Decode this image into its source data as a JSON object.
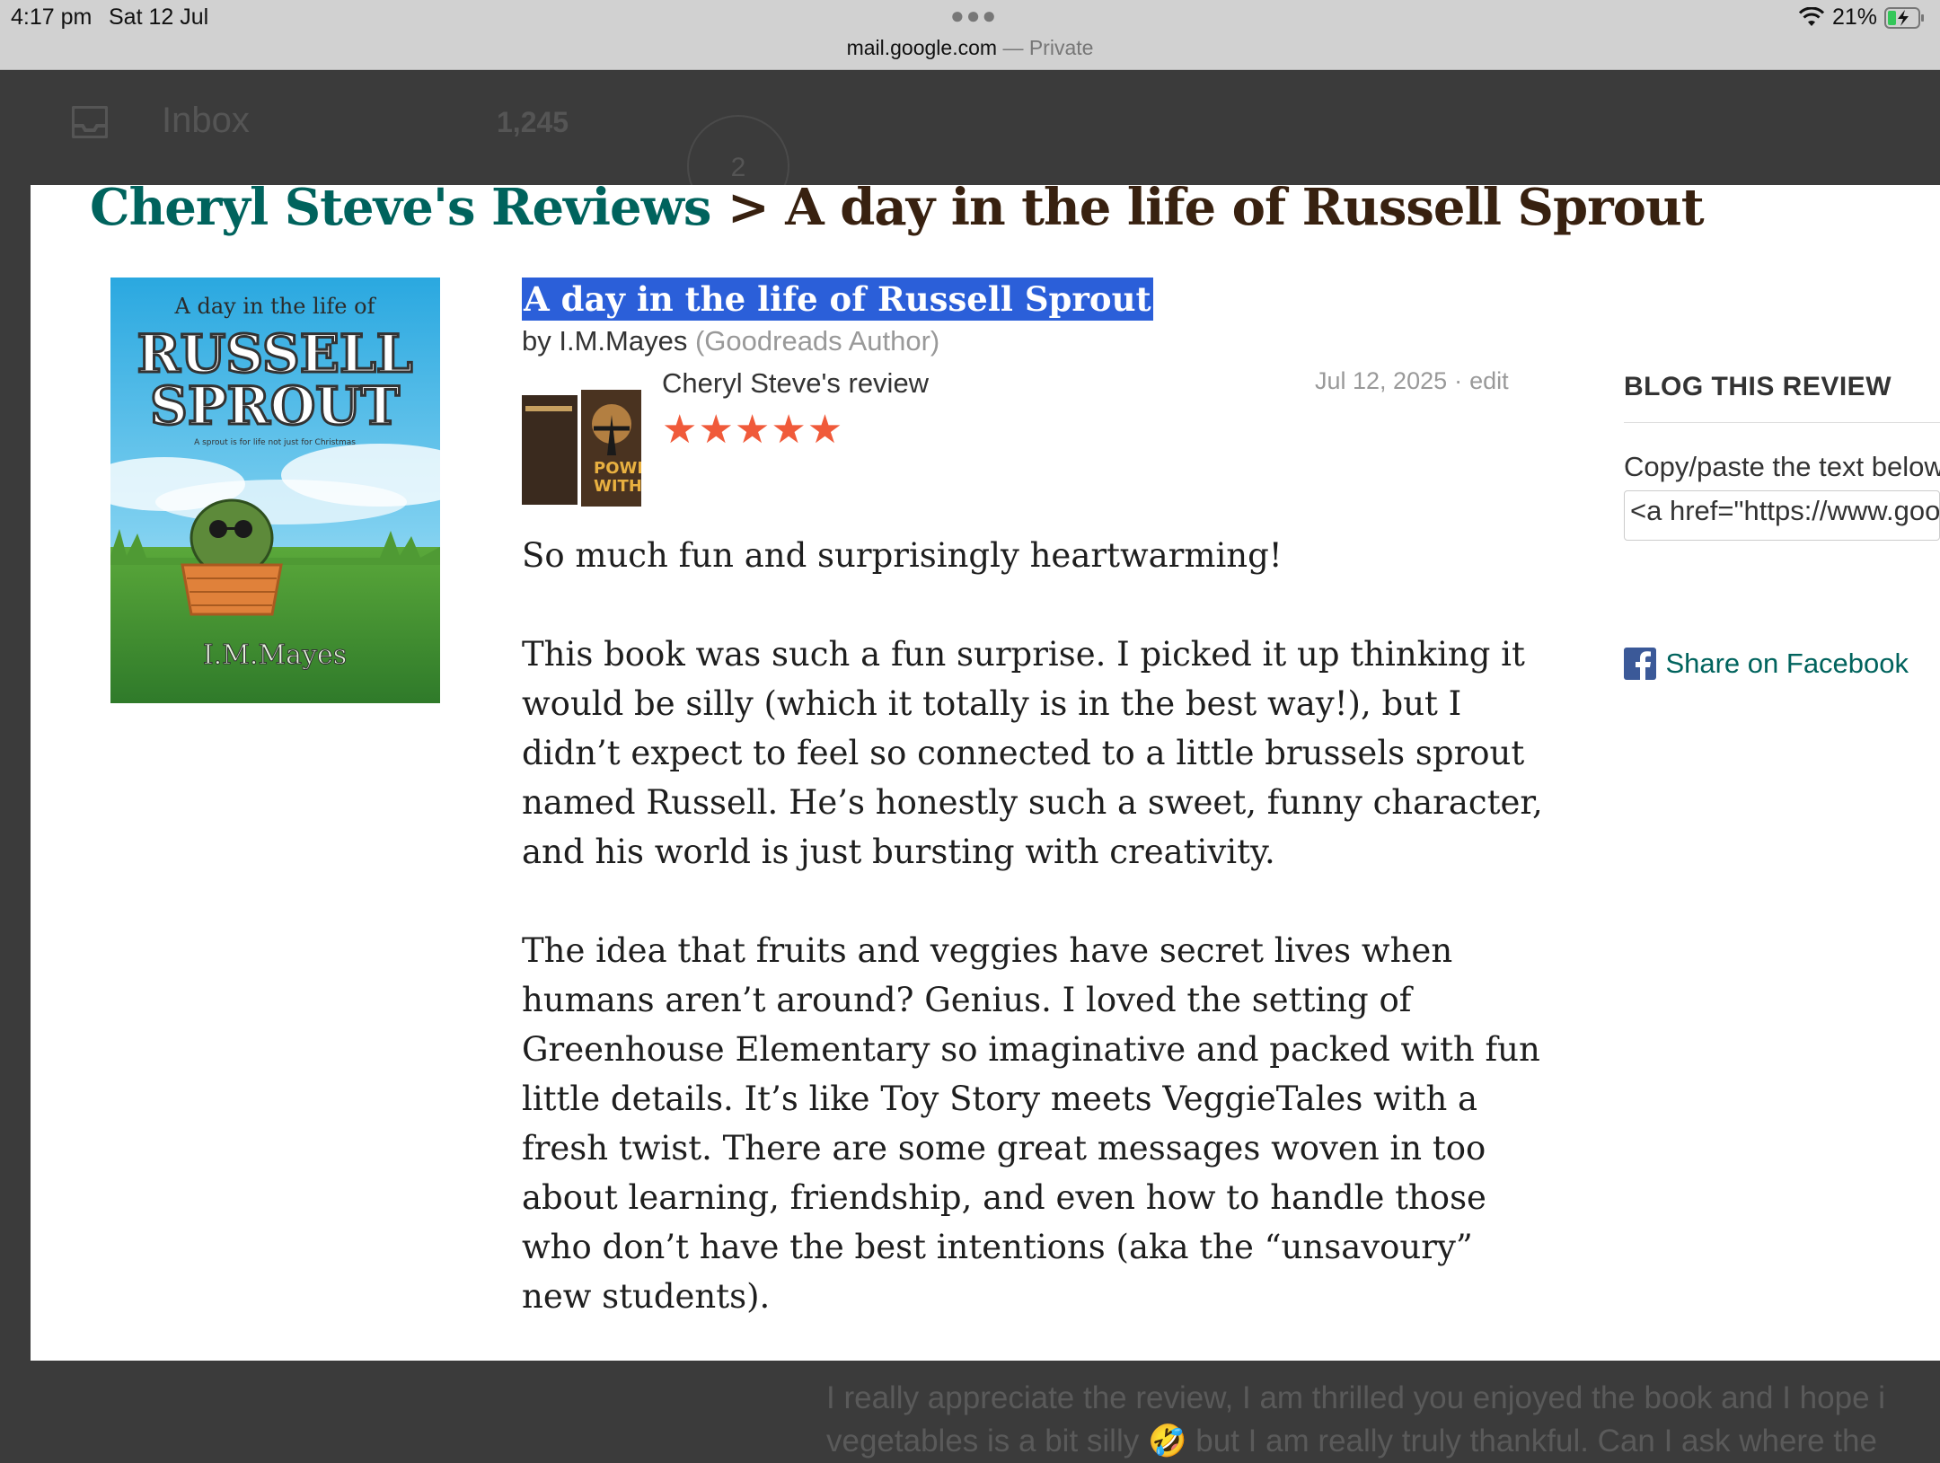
{
  "status_bar": {
    "time": "4:17 pm",
    "date": "Sat 12 Jul",
    "url": "mail.google.com",
    "private_label": "— Private",
    "battery": "21%",
    "icons": [
      "more-dots-icon",
      "wifi-icon",
      "battery-charging-icon"
    ]
  },
  "gmail_background": {
    "inbox_label": "Inbox",
    "inbox_count": "1,245",
    "badge": "2",
    "reply_lines": [
      "I really appreciate the review, I am thrilled you enjoyed the book and I hope i",
      "vegetables is a bit silly 🤣 but I am really truly thankful. Can I ask where the"
    ]
  },
  "review_page": {
    "breadcrumb_reviewer": "Cheryl Steve's Reviews",
    "breadcrumb_separator": ">",
    "breadcrumb_book": "A day in the life of Russell Sprout",
    "book_title": "A day in the life of Russell Sprout",
    "by": "by",
    "author": "I.M.Mayes",
    "author_tag": "(Goodreads Author)",
    "cover": {
      "small_title": "A day in the life of",
      "title_line1": "RUSSELL",
      "title_line2": "SPROUT",
      "tagline": "A sprout is for life not just for Christmas",
      "cover_author": "I.M.Mayes"
    },
    "avatar_text": [
      "POWE",
      "WITHI"
    ],
    "reviewer_label": "Cheryl Steve's review",
    "rating": 5,
    "stars": "★★★★★",
    "review_date": "Jul 12, 2025",
    "date_separator": "·",
    "edit_label": "edit",
    "review_paragraphs": [
      "So much fun and surprisingly heartwarming!",
      "This book was such a fun surprise. I picked it up thinking it\nwould be silly (which it totally is in the best way!), but I\ndidn’t expect to feel so connected to a little brussels sprout\nnamed Russell. He’s honestly such a sweet, funny character,\nand his world is just bursting with creativity.",
      "The idea that fruits and veggies have secret lives when\nhumans aren’t around? Genius. I loved the setting of\nGreenhouse Elementary so imaginative and packed with fun\nlittle details. It’s like Toy Story meets VeggieTales with a\nfresh twist. There are some great messages woven in too\nabout learning, friendship, and even how to handle those\nwho don’t have the best intentions (aka the “unsavoury”\nnew students)."
    ],
    "blog_heading": "BLOG THIS REVIEW",
    "blog_instructions": "Copy/paste the text below",
    "blog_code": "<a href=\"https://www.goodreads.com",
    "share_facebook": "Share on Facebook",
    "colors": {
      "goodreads_teal": "#00635d",
      "goodreads_brown": "#382110",
      "star_color": "#f05a3a",
      "selection_blue": "#2b5fd9"
    }
  }
}
